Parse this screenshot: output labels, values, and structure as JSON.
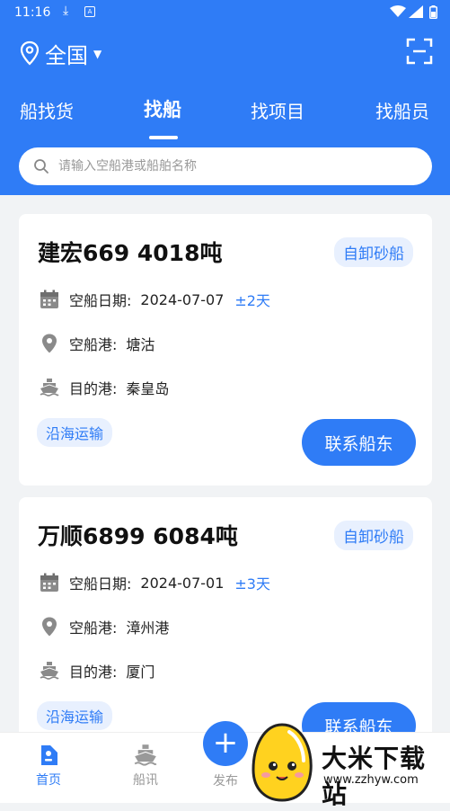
{
  "status_bar": {
    "time": "11:16"
  },
  "header": {
    "location": "全国",
    "tabs": [
      {
        "label": "船找货"
      },
      {
        "label": "找船"
      },
      {
        "label": "找项目"
      },
      {
        "label": "找船员"
      }
    ],
    "active_tab": 1,
    "search": {
      "placeholder": "请输入空船港或船舶名称"
    }
  },
  "ships": [
    {
      "title": "建宏669   4018吨",
      "type": "自卸砂船",
      "date_label": "空船日期:",
      "date": "2024-07-07",
      "tolerance": "±2天",
      "port_label": "空船港:",
      "port": "塘沽",
      "dest_label": "目的港:",
      "dest": "秦皇岛",
      "tag": "沿海运输",
      "contact_label": "联系船东"
    },
    {
      "title": "万顺6899   6084吨",
      "type": "自卸砂船",
      "date_label": "空船日期:",
      "date": "2024-07-01",
      "tolerance": "±3天",
      "port_label": "空船港:",
      "port": "漳州港",
      "dest_label": "目的港:",
      "dest": "厦门",
      "tag": "沿海运输",
      "contact_label": "联系船东"
    }
  ],
  "bottom_nav": {
    "home": "首页",
    "news": "船讯",
    "publish": "发布",
    "publish_symbol": "+"
  },
  "watermark": {
    "name": "大米下载站",
    "url": "www.zzhyw.com"
  },
  "colors": {
    "primary": "#2f7cf6",
    "badge_bg": "#e8f0fe",
    "background": "#f1f3f5"
  }
}
